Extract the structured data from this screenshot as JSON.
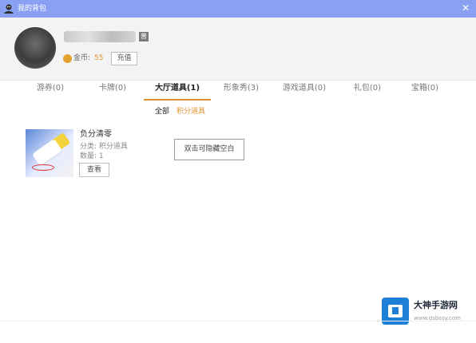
{
  "window": {
    "title": "我的背包",
    "icon": "app-icon",
    "close_icon": "close-icon",
    "close_glyph": "✕"
  },
  "profile": {
    "level_badge": "普",
    "coin_label": "金币:",
    "coin_value": "55",
    "recharge_label": "充值"
  },
  "tabs": [
    {
      "label": "游券(0)"
    },
    {
      "label": "卡牌(0)"
    },
    {
      "label": "大厅道具(1)",
      "active": true
    },
    {
      "label": "形象秀(3)"
    },
    {
      "label": "游戏道具(0)"
    },
    {
      "label": "礼包(0)"
    },
    {
      "label": "宝箱(0)"
    }
  ],
  "subtabs": [
    {
      "label": "全部",
      "active": true
    },
    {
      "label": "积分道具"
    }
  ],
  "item": {
    "name": "负分清零",
    "category": "分类:  积分道具",
    "quantity": "数量:  1",
    "view_label": "查看",
    "image_icon": "eraser-icon"
  },
  "tooltip": {
    "text": "双击可隐藏空白"
  },
  "watermark": {
    "title": "大神手游网",
    "url": "www.dsbssy.com"
  },
  "colors": {
    "titlebar": "#8aa0f2",
    "accent": "#e0922a",
    "profile_bg": "#f3f3f3"
  }
}
